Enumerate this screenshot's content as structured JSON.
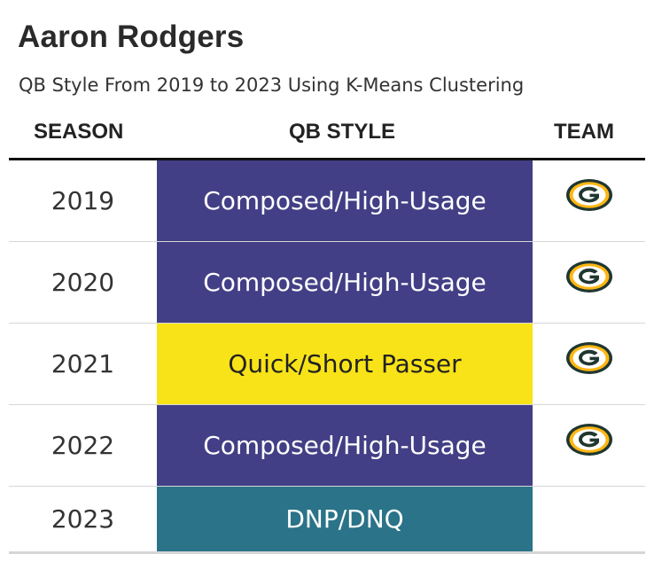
{
  "title": "Aaron Rodgers",
  "subtitle": "QB Style From 2019 to 2023 Using K-Means Clustering",
  "columns": {
    "season": "SEASON",
    "style": "QB STYLE",
    "team": "TEAM"
  },
  "rows": [
    {
      "season": "2019",
      "style": "Composed/High-Usage",
      "style_bg": "#433f86",
      "style_fg": "#ffffff",
      "team_logo": "packers-logo-icon"
    },
    {
      "season": "2020",
      "style": "Composed/High-Usage",
      "style_bg": "#433f86",
      "style_fg": "#ffffff",
      "team_logo": "packers-logo-icon"
    },
    {
      "season": "2021",
      "style": "Quick/Short Passer",
      "style_bg": "#f8e318",
      "style_fg": "#222222",
      "team_logo": "packers-logo-icon"
    },
    {
      "season": "2022",
      "style": "Composed/High-Usage",
      "style_bg": "#433f86",
      "style_fg": "#ffffff",
      "team_logo": "packers-logo-icon"
    },
    {
      "season": "2023",
      "style": "DNP/DNQ",
      "style_bg": "#2a7389",
      "style_fg": "#ffffff",
      "team_logo": null
    }
  ],
  "colors": {
    "packers_green": "#203731",
    "packers_gold": "#ffb612"
  }
}
